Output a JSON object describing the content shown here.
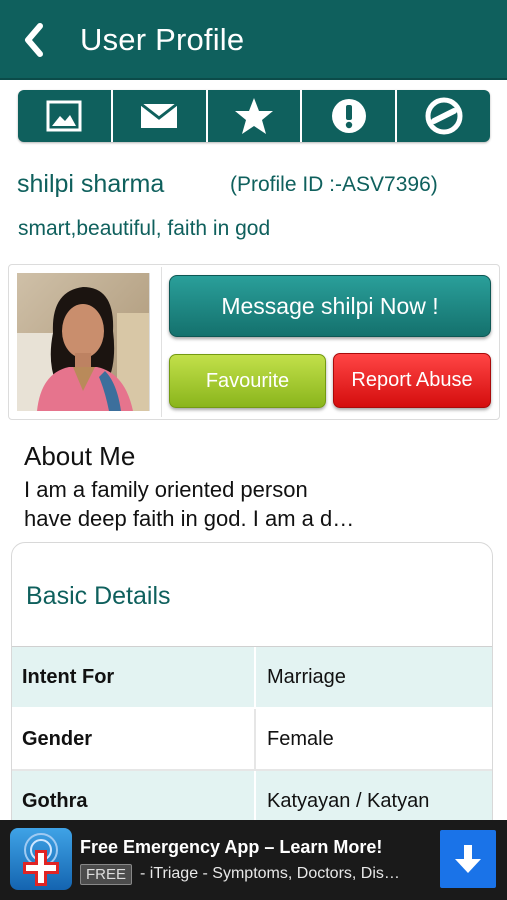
{
  "header": {
    "title": "User Profile",
    "back_icon": "chevron-left-icon",
    "background_color": "#0f605d"
  },
  "toolbar": {
    "items": [
      {
        "icon": "photo-icon"
      },
      {
        "icon": "mail-icon"
      },
      {
        "icon": "star-icon"
      },
      {
        "icon": "alert-icon"
      },
      {
        "icon": "block-icon"
      }
    ]
  },
  "profile": {
    "name": "shilpi sharma",
    "profile_id": "(Profile ID :-ASV7396)",
    "tagline": "smart,beautiful, faith in god"
  },
  "actions": {
    "message_label": "Message shilpi Now !",
    "favourite_label": "Favourite",
    "report_label": "Report Abuse"
  },
  "about": {
    "title": "About Me",
    "text": " I am a family oriented person\nhave deep faith in god. I am a d…"
  },
  "basic_details": {
    "title": "Basic Details",
    "rows": [
      {
        "key": "Intent For",
        "value": "Marriage"
      },
      {
        "key": "Gender",
        "value": "Female"
      },
      {
        "key": "Gothra",
        "value": "Katyayan / Katyan"
      }
    ]
  },
  "ad": {
    "title": "Free Emergency App – Learn More!",
    "badge": "FREE",
    "subtitle": "- iTriage - Symptoms, Doctors, Dis…",
    "download_icon": "download-arrow-icon"
  }
}
